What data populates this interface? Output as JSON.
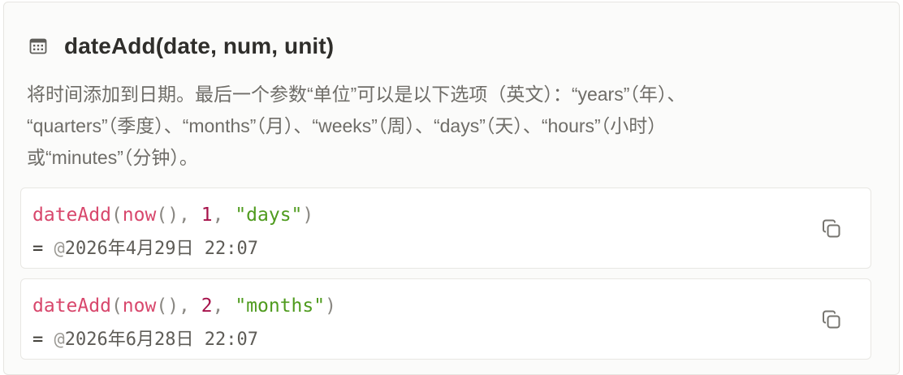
{
  "header": {
    "icon": "calendar-icon",
    "title": "dateAdd(date, num, unit)"
  },
  "description": {
    "line1": "将时间添加到日期。最后一个参数“单位”可以是以下选项（英文）：“years”（年）、",
    "line2": "“quarters”（季度）、“months”（月）、“weeks”（周）、“days”（天）、“hours”（小时）",
    "line3": "或“minutes”（分钟）。"
  },
  "examples": [
    {
      "fn": "dateAdd",
      "open": "(",
      "inner_fn": "now",
      "inner_parens": "()",
      "sep1": ", ",
      "num": "1",
      "sep2": ", ",
      "unit": "\"days\"",
      "close": ")",
      "result_eq": "= ",
      "result_at": "@",
      "result_value": "2026年4月29日 22:07",
      "copy_icon": "copy-icon"
    },
    {
      "fn": "dateAdd",
      "open": "(",
      "inner_fn": "now",
      "inner_parens": "()",
      "sep1": ", ",
      "num": "2",
      "sep2": ", ",
      "unit": "\"months\"",
      "close": ")",
      "result_eq": "= ",
      "result_at": "@",
      "result_value": "2026年6月28日 22:07",
      "copy_icon": "copy-icon"
    }
  ],
  "colors": {
    "function": "#d8476c",
    "number": "#a6124b",
    "string": "#4f9b1e"
  }
}
